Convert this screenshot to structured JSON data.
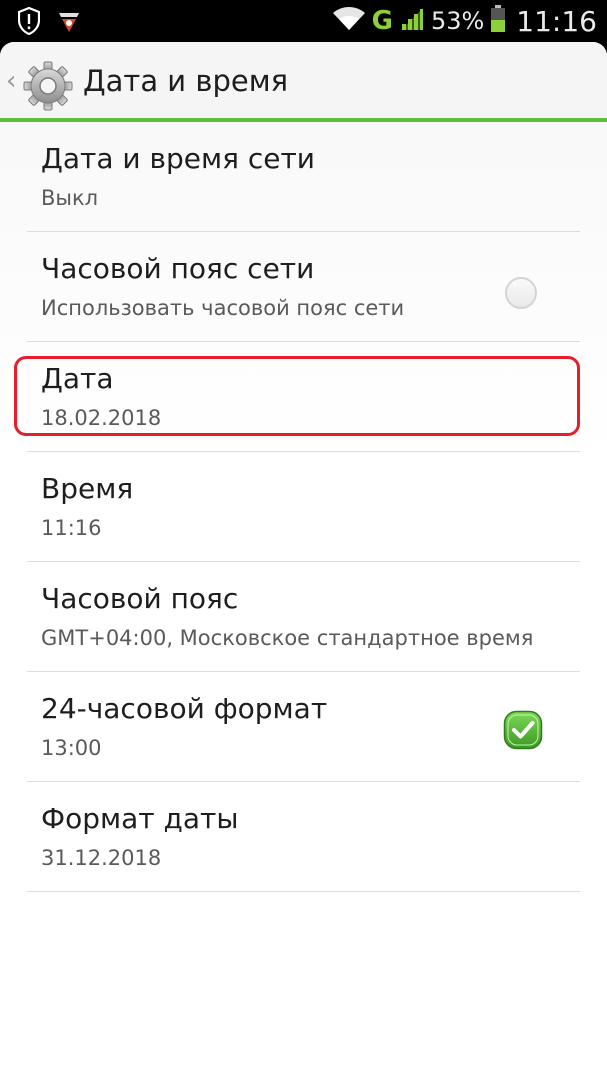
{
  "status_bar": {
    "network": "G",
    "battery_percent": "53%",
    "time": "11:16",
    "icons": [
      "shield-alert-icon",
      "app-notification-icon",
      "wifi-icon",
      "signal-icon",
      "battery-icon"
    ]
  },
  "action_bar": {
    "title": "Дата и время",
    "icon": "gear-icon",
    "back": "‹"
  },
  "settings": [
    {
      "title": "Дата и время сети",
      "summary": "Выкл"
    },
    {
      "title": "Часовой пояс сети",
      "summary": "Использовать часовой пояс сети",
      "checkbox": "unchecked"
    },
    {
      "title": "Дата",
      "summary": "18.02.2018",
      "highlighted": true
    },
    {
      "title": "Время",
      "summary": "11:16"
    },
    {
      "title": "Часовой пояс",
      "summary": "GMT+04:00, Московское стандартное время"
    },
    {
      "title": "24-часовой формат",
      "summary": "13:00",
      "checkbox": "checked"
    },
    {
      "title": "Формат даты",
      "summary": "31.12.2018"
    }
  ],
  "colors": {
    "accent": "#5bbf3b",
    "highlight": "#e41e2b",
    "network": "#8dd13a"
  }
}
